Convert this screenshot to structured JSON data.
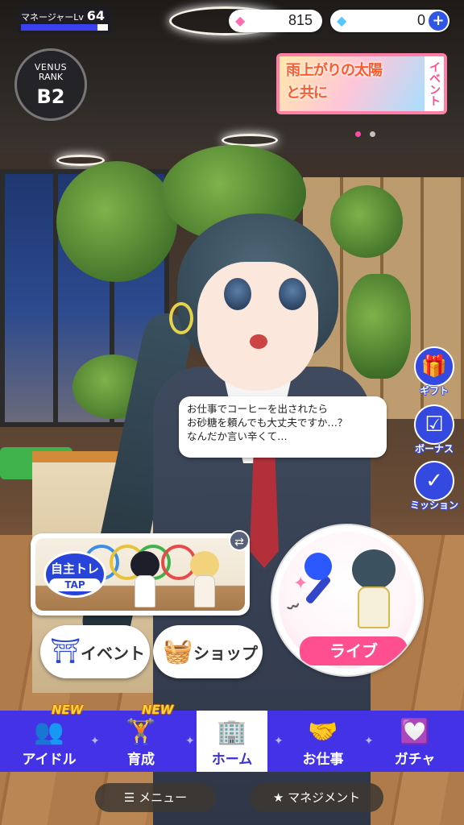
{
  "hud": {
    "manager_label": "マネージャーLv",
    "manager_level": "64",
    "manager_progress": 0.88,
    "paid_gems": "815",
    "free_gems": "0",
    "plus_label": "+"
  },
  "rank": {
    "line1": "VENUS",
    "line2": "RANK",
    "value": "B2"
  },
  "event_banner": {
    "title": "雨上がりの太陽と共に",
    "side_label": "イベント"
  },
  "side_buttons": [
    {
      "label": "ギフト",
      "icon": "gift-icon"
    },
    {
      "label": "ボーナス",
      "icon": "calendar-check-icon"
    },
    {
      "label": "ミッション",
      "icon": "clipboard-check-icon"
    }
  ],
  "speech": {
    "line1": "お仕事でコーヒーを出されたら",
    "line2": "お砂糖を頼んでも大丈夫ですか…？",
    "line3": "なんだか言い辛くて…"
  },
  "training": {
    "label": "自主トレ",
    "tap": "TAP"
  },
  "buttons": {
    "event": "イベント",
    "shop": "ショップ",
    "live": "ライブ"
  },
  "nav": [
    {
      "label": "アイドル",
      "icon": "idols-icon",
      "badge": "NEW",
      "active": false
    },
    {
      "label": "育成",
      "icon": "dumbbell-icon",
      "badge": "NEW",
      "active": false
    },
    {
      "label": "ホーム",
      "icon": "building-icon",
      "badge": "",
      "active": true
    },
    {
      "label": "お仕事",
      "icon": "handshake-icon",
      "badge": "",
      "active": false
    },
    {
      "label": "ガチャ",
      "icon": "heart-badge-icon",
      "badge": "",
      "active": false
    }
  ],
  "footer": {
    "menu": "メニュー",
    "management": "マネジメント"
  },
  "colors": {
    "nav_bg": "#4433e6",
    "accent_blue": "#2944d8",
    "live_pink": "#ff4f8e",
    "new_badge": "#ffd23a"
  }
}
